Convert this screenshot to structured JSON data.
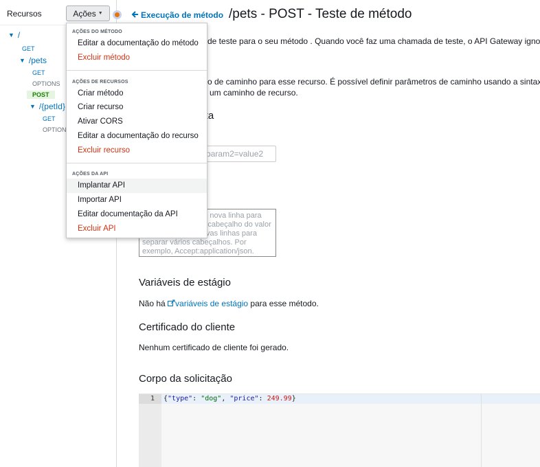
{
  "sidebar": {
    "title": "Recursos",
    "actions_label": "Ações"
  },
  "tree": {
    "root": "/",
    "root_get": "GET",
    "pets": "/pets",
    "pets_get": "GET",
    "pets_options": "OPTIONS",
    "pets_post": "POST",
    "petid": "/{petId}",
    "petid_get": "GET",
    "petid_options": "OPTIONS"
  },
  "header": {
    "back_label": "Execução de método",
    "title": "/pets - POST - Teste de método"
  },
  "main": {
    "intro_visible": "de teste para o seu método . Quando você faz uma chamada de teste, o API Gateway ignora a a",
    "path_line1": "ro de caminho para esse recurso. É possível definir parâmetros de caminho usando a sintaxe",
    "path_line2": "um caminho de recurso.",
    "query_heading_visible": "ulta",
    "query_placeholder": "param1=value1&param2=value2",
    "headers_placeholder": "Use uma vírgula ou nova linha para separar o nome do cabeçalho do valor do cabeçalho, e novas linhas para separar vários cabeçalhos. Por exemplo, Accept:application/json.",
    "stage_vars_heading": "Variáveis de estágio",
    "stage_vars_prefix": "Não há ",
    "stage_vars_link": "variáveis de estágio",
    "stage_vars_suffix": " para esse método.",
    "client_cert_heading": "Certificado do cliente",
    "client_cert_text": "Nenhum certificado de cliente foi gerado.",
    "body_heading": "Corpo da solicitação"
  },
  "editor": {
    "line_number": "1",
    "code": "{\"type\": \"dog\", \"price\": 249.99}",
    "tk_open": "{",
    "tk_key1": "\"type\"",
    "tk_colon1": ": ",
    "tk_val1": "\"dog\"",
    "tk_sep": ", ",
    "tk_key2": "\"price\"",
    "tk_colon2": ": ",
    "tk_val2": "249.99",
    "tk_close": "}"
  },
  "dropdown": {
    "method_head": "AÇÕES DO MÉTODO",
    "edit_method_docs": "Editar a documentação do método",
    "delete_method": "Excluir método",
    "resource_head": "AÇÕES DE RECURSOS",
    "create_method": "Criar método",
    "create_resource": "Criar recurso",
    "enable_cors": "Ativar CORS",
    "edit_resource_docs": "Editar a documentação do recurso",
    "delete_resource": "Excluir recurso",
    "api_head": "AÇÕES DA API",
    "deploy_api": "Implantar API",
    "import_api": "Importar API",
    "edit_api_docs": "Editar documentação da API",
    "delete_api": "Excluir API"
  },
  "colors": {
    "link": "#0073bb",
    "danger": "#d13212",
    "selected_method_bg": "#e6f4e2",
    "selected_method_fg": "#1d8102",
    "status_dot": "#ec7211"
  }
}
